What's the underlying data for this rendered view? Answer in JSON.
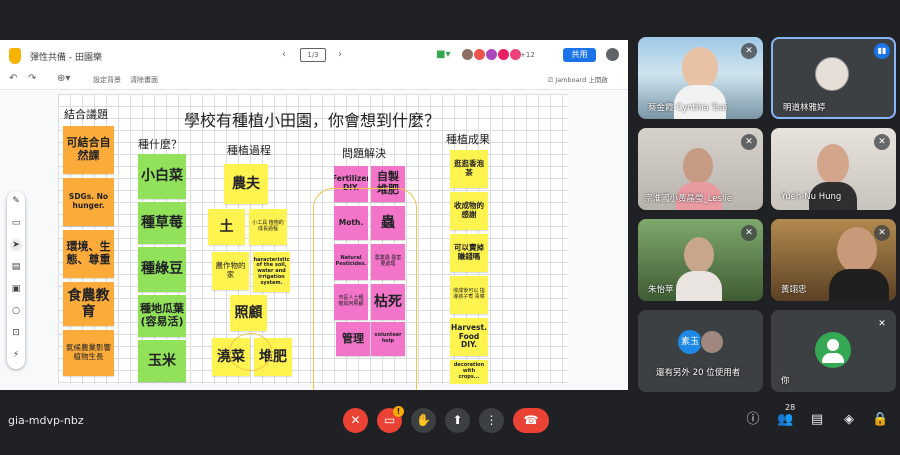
{
  "meeting": {
    "code": "gia-mdvp-nbz",
    "participant_count": "28"
  },
  "jamboard": {
    "file_title": "彈性共備 - 田園樂",
    "frame_label": "1/3",
    "share_label": "共用",
    "avatar_more": "+12",
    "set_background": "設定背景",
    "clear_frame": "清除畫面",
    "jamboard_button": "Jamboard 上開啟",
    "board_title": "學校有種植小田園，你會想到什麼？",
    "headers": {
      "combine": "結合議題",
      "what": "種什麼？",
      "process": "種植過程",
      "problem": "問題解決",
      "result": "種植成果"
    },
    "notes": {
      "combine": [
        "可結合自然課",
        "SDGs. No hunger.",
        "環境、生態、尊重",
        "食農教育",
        "氣候農業影響植物生長"
      ],
      "what": [
        "小白菜",
        "種草莓",
        "種綠豆",
        "種地瓜葉(容易活)",
        "玉米"
      ],
      "process": [
        "農夫",
        "土",
        "小工具 植物的成長過程",
        "農作物的家",
        "characteristics of the soil, water and irrigation system.",
        "照顧",
        "澆菜",
        "堆肥"
      ],
      "problem": [
        "Fertilizer DIY.",
        "自製堆肥",
        "Moth.",
        "蟲",
        "Natural Pesticides.",
        "農業蟲 蟲害要處理",
        "市區人士種 植如何照顧",
        "枯死",
        "管理",
        "volunteer help"
      ],
      "result": [
        "逛逛香泡茶",
        "收成物的感謝",
        "可以賣掉賺錢嗎",
        "收成後可以 指導孩子煮 青菜",
        "Harvest. Food DIY.",
        "decoration with crops..."
      ]
    }
  },
  "participants": [
    {
      "name": "蔡金霞 Cynthia Tsai"
    },
    {
      "name": "明道林雅婷"
    },
    {
      "name": "宗淮國小黃晶瑩_Leslie"
    },
    {
      "name": "Yueh-Nu Hung"
    },
    {
      "name": "朱怡苹"
    },
    {
      "name": "黃翊忠"
    },
    {
      "name": "還有另外 20 位使用者",
      "avatar_label": "素玉"
    },
    {
      "name": "你"
    }
  ],
  "icons": {
    "mic_off": "mic-off-icon",
    "camera_off": "camera-off-icon",
    "hand": "raise-hand-icon",
    "present": "present-icon",
    "more": "more-icon",
    "end": "end-call-icon"
  },
  "colors": {
    "orange": "#fbab3a",
    "green": "#92e15b",
    "yellow": "#fff34f",
    "pink": "#f275c9",
    "end_call": "#ea4335",
    "share": "#1a73e8"
  }
}
